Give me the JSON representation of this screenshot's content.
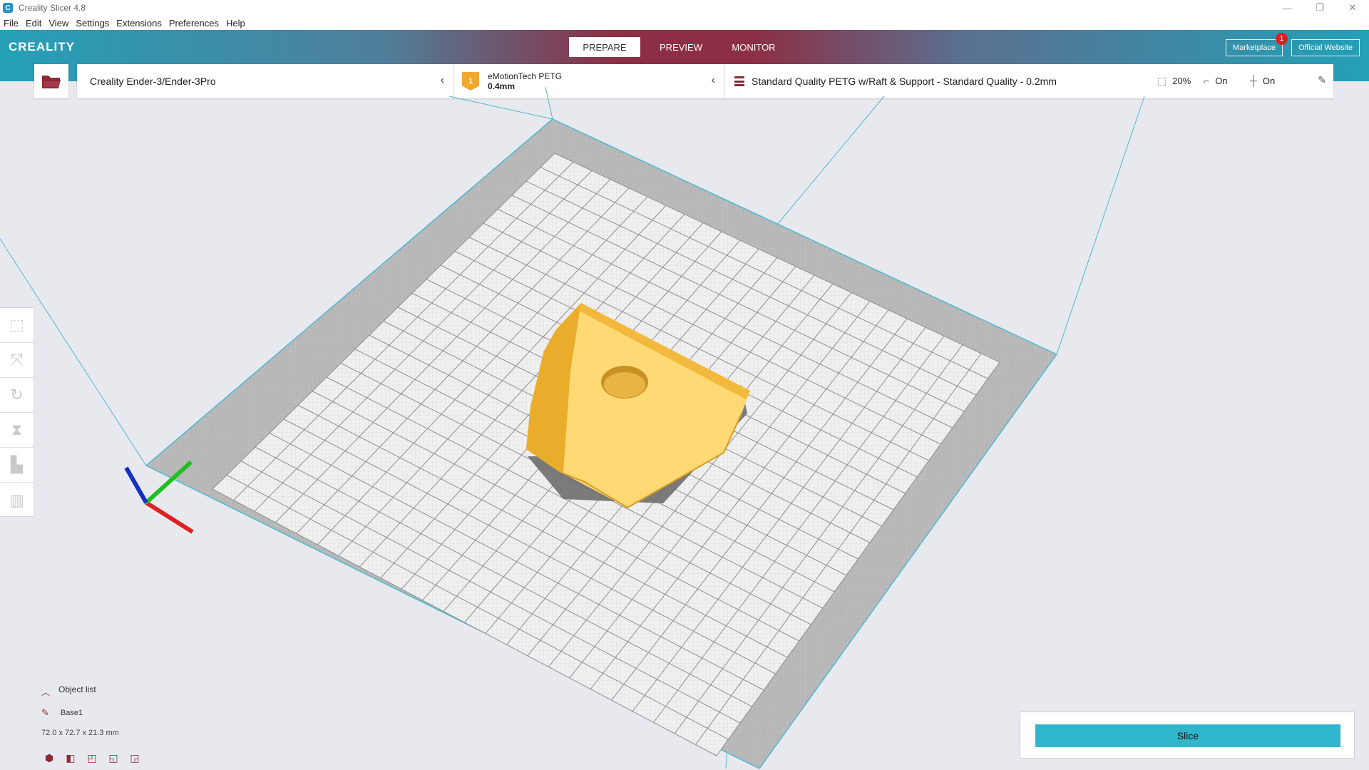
{
  "window": {
    "title": "Creality Slicer 4.8",
    "app_icon": "C",
    "controls": {
      "minimize": "—",
      "maximize": "❐",
      "close": "✕"
    }
  },
  "menu": [
    "File",
    "Edit",
    "View",
    "Settings",
    "Extensions",
    "Preferences",
    "Help"
  ],
  "header": {
    "logo": "CREALITY",
    "tabs": [
      {
        "label": "PREPARE",
        "active": true
      },
      {
        "label": "PREVIEW",
        "active": false
      },
      {
        "label": "MONITOR",
        "active": false
      }
    ],
    "marketplace": "Marketplace",
    "marketplace_badge": "1",
    "official_website": "Official Website"
  },
  "settings": {
    "printer": "Creality Ender-3/Ender-3Pro",
    "extruder_number": "1",
    "material": "eMotionTech PETG",
    "nozzle": "0.4mm",
    "profile": "Standard Quality PETG w/Raft & Support - Standard Quality - 0.2mm",
    "infill": "20%",
    "support": "On",
    "adhesion": "On"
  },
  "object_list": {
    "title": "Object list",
    "object_name": "Base1",
    "dimensions": "72.0 x 72.7 x 21.3 mm"
  },
  "slice": {
    "label": "Slice"
  },
  "colors": {
    "accent": "#2fb7cc",
    "brand_dark": "#8c2f44",
    "model": "#f8c548",
    "axis_x": "#e02020",
    "axis_y": "#20c020",
    "axis_z": "#1530c0"
  }
}
